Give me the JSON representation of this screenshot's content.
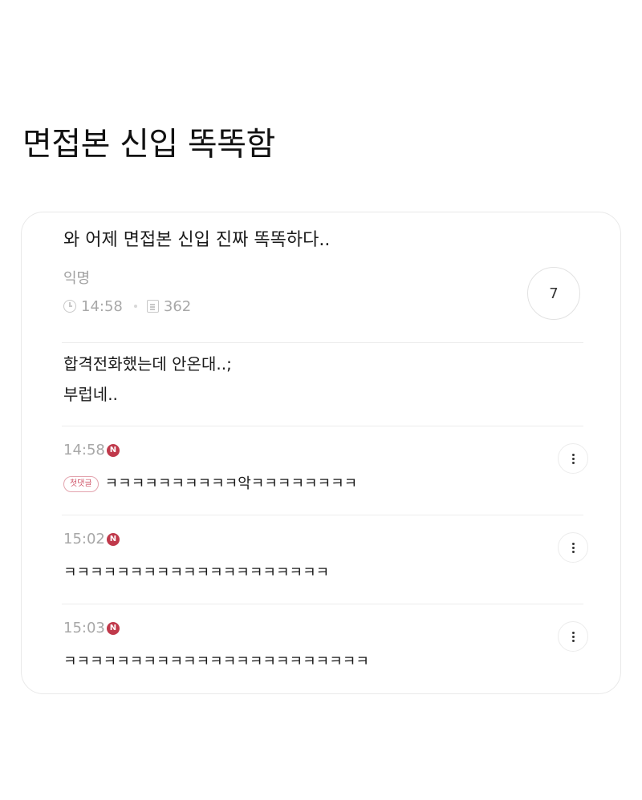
{
  "page_title": "면접본 신입 똑똑함",
  "post": {
    "title": "와 어제 면접본 신입 진짜 똑똑하다..",
    "author": "익명",
    "time": "14:58",
    "views": "362",
    "comment_count": "7",
    "body_line1": "합격전화했는데 안온대..;",
    "body_line2": "부럽네.."
  },
  "comments": [
    {
      "time": "14:58",
      "badge": "N",
      "tag": "첫댓글",
      "text": "ㅋㅋㅋㅋㅋㅋㅋㅋㅋㅋ악ㅋㅋㅋㅋㅋㅋㅋㅋ"
    },
    {
      "time": "15:02",
      "badge": "N",
      "text": "ㅋㅋㅋㅋㅋㅋㅋㅋㅋㅋㅋㅋㅋㅋㅋㅋㅋㅋㅋㅋ"
    },
    {
      "time": "15:03",
      "badge": "N",
      "text": "ㅋㅋㅋㅋㅋㅋㅋㅋㅋㅋㅋㅋㅋㅋㅋㅋㅋㅋㅋㅋㅋㅋㅋ"
    }
  ],
  "colors": {
    "badge": "#c0394b",
    "tag_border": "#e3a4ae",
    "tag_text": "#d0566a",
    "meta_text": "#a8a8a8"
  },
  "icons": {
    "clock": "clock-icon",
    "views": "views-icon",
    "more": "more-vertical-icon"
  }
}
